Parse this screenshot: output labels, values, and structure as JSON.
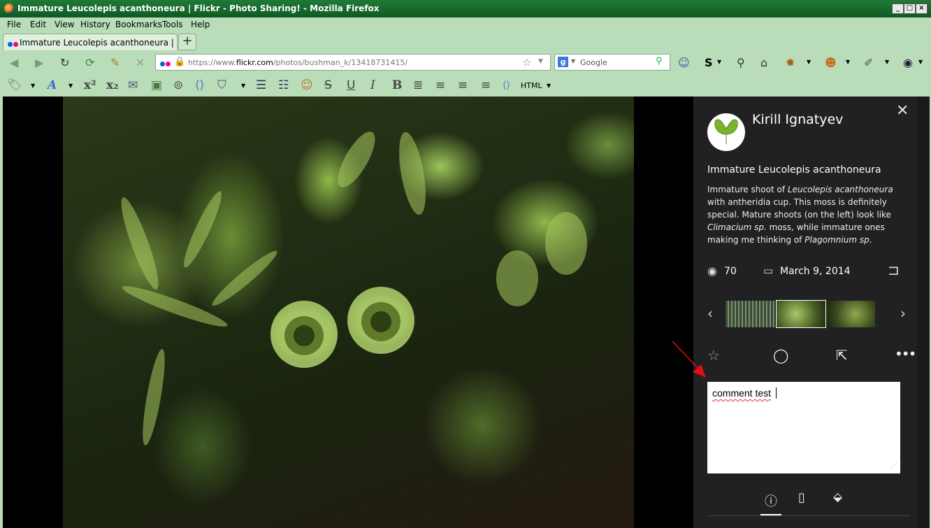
{
  "window": {
    "title": "Immature Leucolepis acanthoneura | Flickr - Photo Sharing! - Mozilla Firefox",
    "min_label": "_",
    "max_label": "□",
    "close_label": "×"
  },
  "menu": {
    "items": [
      "File",
      "Edit",
      "View",
      "History",
      "Bookmarks",
      "Tools",
      "Help"
    ]
  },
  "tabs": {
    "active_label": "Immature Leucolepis acanthoneura | Flickr - ...",
    "new_tab_label": "+"
  },
  "address": {
    "url_prefix": "https://www.",
    "url_domain": "flickr.com",
    "url_path": "/photos/bushman_k/13418731415/"
  },
  "search": {
    "engine_label": "g",
    "placeholder": "Google"
  },
  "format_toolbar": {
    "html_label": "HTML"
  },
  "panel": {
    "owner_name": "Kirill Ignatyev",
    "photo_title": "Immature Leucolepis acanthoneura",
    "description": [
      {
        "text": "Immature shoot of ",
        "italic": false
      },
      {
        "text": "Leucolepis acanthoneura",
        "italic": true
      },
      {
        "text": " with antheridia cup. This moss is definitely special. Mature shoots (on the left) look like ",
        "italic": false
      },
      {
        "text": "Climacium sp.",
        "italic": true
      },
      {
        "text": " moss, while immature ones making me thinking of ",
        "italic": false
      },
      {
        "text": "Plagomnium sp",
        "italic": true
      },
      {
        "text": ".",
        "italic": false
      }
    ],
    "views": "70",
    "date": "March 9, 2014",
    "comment_text": "comment test"
  },
  "colors": {
    "titlebar": "#1a6e30",
    "chrome": "#b9dcb9",
    "panel_bg": "#212124",
    "arrow": "#e01010"
  }
}
